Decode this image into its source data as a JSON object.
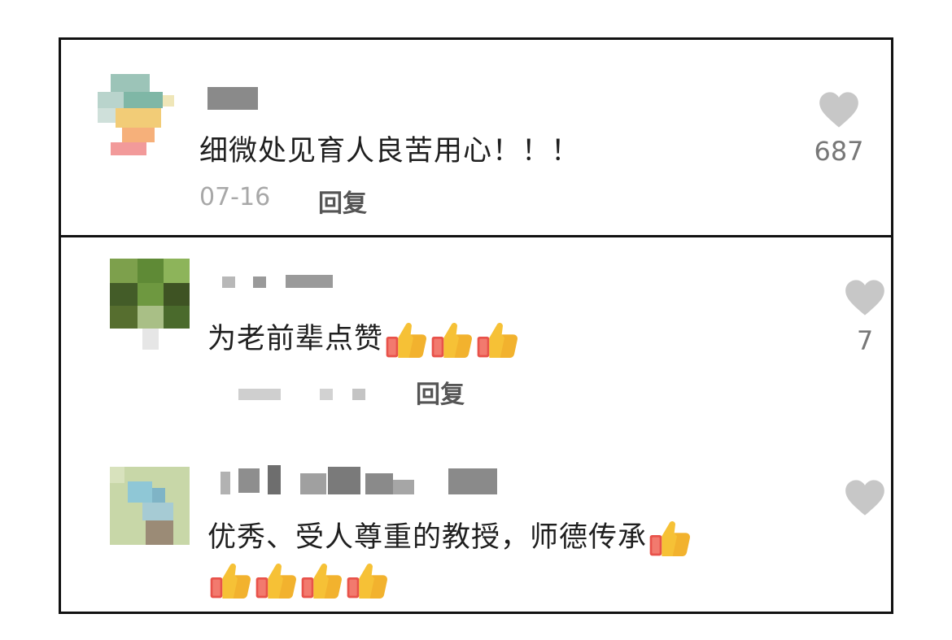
{
  "comments": [
    {
      "text": "细微处见育人良苦用心！！！",
      "date": "07-16",
      "reply_label": "回复",
      "likes": "687",
      "thumbs_inline": 0,
      "thumbs_next_line": 0
    },
    {
      "text": "为老前辈点赞",
      "reply_label": "回复",
      "likes": "7",
      "thumbs_inline": 3,
      "thumbs_next_line": 0
    },
    {
      "text": "优秀、受人尊重的教授，师德传承",
      "reply_label": "",
      "likes": "",
      "thumbs_inline": 1,
      "thumbs_next_line": 4
    }
  ],
  "icons": {
    "like": "heart-icon",
    "emoji": "thumbs-up-icon"
  },
  "colors": {
    "heart": "#c7c7c7",
    "text": "#1f1f1f",
    "meta": "#a8a8a8",
    "border": "#111111"
  }
}
